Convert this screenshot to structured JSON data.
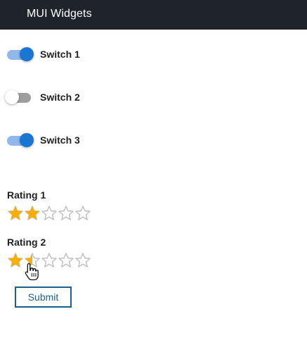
{
  "appbar": {
    "title": "MUI Widgets"
  },
  "switches": [
    {
      "label": "Switch 1",
      "checked": true
    },
    {
      "label": "Switch 2",
      "checked": false
    },
    {
      "label": "Switch 3",
      "checked": true
    }
  ],
  "ratings": [
    {
      "label": "Rating 1",
      "value": 2,
      "max": 5
    },
    {
      "label": "Rating 2",
      "value": 1.5,
      "max": 5
    }
  ],
  "submit": {
    "label": "Submit"
  },
  "colors": {
    "appbar_bg": "#1f242a",
    "switch_on_thumb": "#1976d2",
    "switch_on_track": "#90b8ea",
    "switch_off_track": "#9e9e9e",
    "star_filled": "#faaf00",
    "star_empty": "#bdbdbd",
    "submit_border": "#1c5f8f"
  },
  "cursor": {
    "icon": "hand-pointer-icon"
  }
}
